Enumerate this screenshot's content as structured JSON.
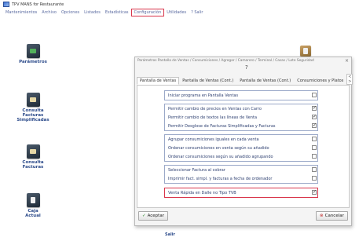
{
  "window": {
    "title": "TPV MANS for Restaurante"
  },
  "menu": [
    "Mantenimientos",
    "Archivo",
    "Opciones",
    "Listados",
    "Estadísticas",
    "Configuración",
    "Utilidades",
    "? Salir"
  ],
  "desktop": [
    {
      "label": "Parámetros"
    },
    {
      "label": "Consulta Facturas Simplificadas"
    },
    {
      "label": "Consulta Facturas"
    },
    {
      "label": "Caja Actual"
    }
  ],
  "desktop_bottom": "Salir",
  "dialog": {
    "title": "Parámetros Pantalla de Ventas / Consumiciones / Agregar / Camarero / Terminal / Casas / Lote Seguridad",
    "close": "×",
    "emblem": "?",
    "tabs": [
      "Pantalla de Ventas",
      "Pantalla de Ventas (Cont.)",
      "Pantalla de Ventas (Cont.)",
      "Consumiciones y Platos"
    ],
    "tab_scroll": "< >",
    "groups": [
      {
        "options": [
          {
            "label": "Iniciar programa en Pantalla Ventas",
            "checked": false
          }
        ]
      },
      {
        "options": [
          {
            "label": "Permitir cambio de precios en Ventas con Carro",
            "checked": true
          },
          {
            "label": "Permitir cambio de textos las líneas de Venta",
            "checked": true
          },
          {
            "label": "Permitir Desglose de Facturas Simplificadas y Facturas",
            "checked": true
          }
        ]
      },
      {
        "options": [
          {
            "label": "Agrupar consumiciones iguales en cada venta",
            "checked": false
          },
          {
            "label": "Ordenar consumiciones en venta según su añadido",
            "checked": false
          },
          {
            "label": "Ordenar consumiciones según su añadido agrupando",
            "checked": false
          }
        ]
      },
      {
        "options": [
          {
            "label": "Seleccionar Factura al cobrar",
            "checked": false
          },
          {
            "label": "Imprimir fact. simpl. y facturas a fecha de ordenador",
            "checked": false
          }
        ]
      },
      {
        "highlight": true,
        "options": [
          {
            "label": "Venta Rápida en Dalle no Tipo TVB",
            "checked": true
          }
        ]
      }
    ],
    "accept_label": "Aceptar",
    "cancel_label": "Cancelar"
  },
  "colors": {
    "highlight": "#d8344a",
    "menu_text": "#5a6aa0",
    "label_text": "#2b4a8a"
  }
}
